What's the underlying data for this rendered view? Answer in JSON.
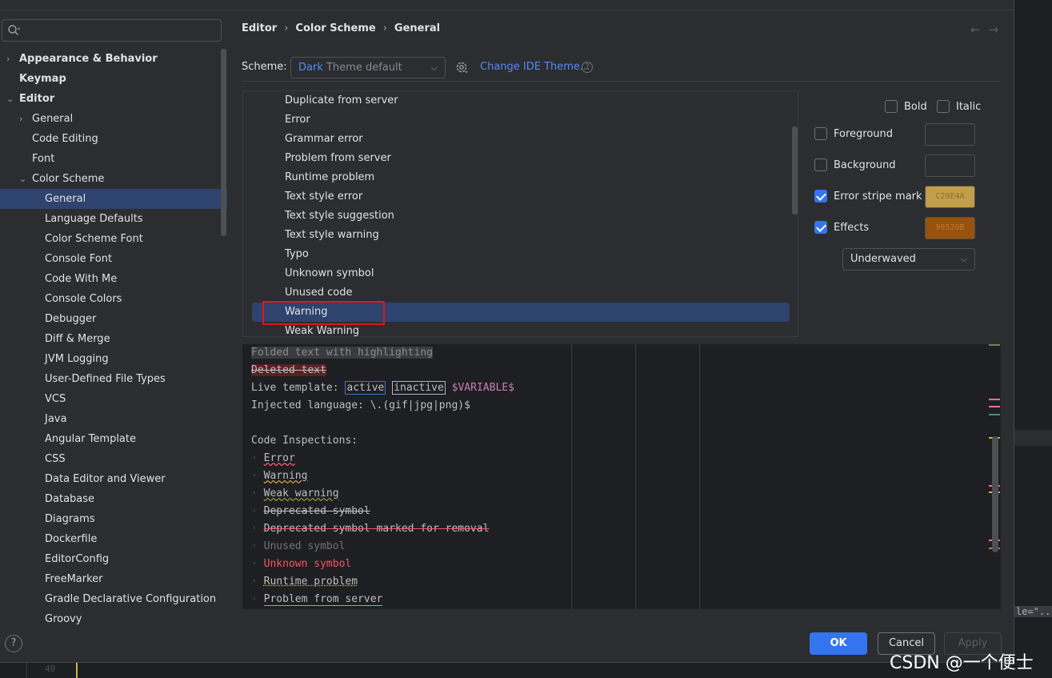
{
  "search": {
    "placeholder": ""
  },
  "sidebar": {
    "items": [
      {
        "label": "Appearance & Behavior",
        "level": 0,
        "bold": true,
        "arrow": "›"
      },
      {
        "label": "Keymap",
        "level": 0,
        "bold": true,
        "arrow": ""
      },
      {
        "label": "Editor",
        "level": 0,
        "bold": true,
        "arrow": "⌄"
      },
      {
        "label": "General",
        "level": 1,
        "bold": false,
        "arrow": "›"
      },
      {
        "label": "Code Editing",
        "level": 1,
        "bold": false,
        "arrow": ""
      },
      {
        "label": "Font",
        "level": 1,
        "bold": false,
        "arrow": ""
      },
      {
        "label": "Color Scheme",
        "level": 1,
        "bold": false,
        "arrow": "⌄"
      },
      {
        "label": "General",
        "level": 2,
        "bold": false,
        "arrow": "",
        "selected": true
      },
      {
        "label": "Language Defaults",
        "level": 2,
        "bold": false,
        "arrow": ""
      },
      {
        "label": "Color Scheme Font",
        "level": 2,
        "bold": false,
        "arrow": ""
      },
      {
        "label": "Console Font",
        "level": 2,
        "bold": false,
        "arrow": ""
      },
      {
        "label": "Code With Me",
        "level": 2,
        "bold": false,
        "arrow": ""
      },
      {
        "label": "Console Colors",
        "level": 2,
        "bold": false,
        "arrow": ""
      },
      {
        "label": "Debugger",
        "level": 2,
        "bold": false,
        "arrow": ""
      },
      {
        "label": "Diff & Merge",
        "level": 2,
        "bold": false,
        "arrow": ""
      },
      {
        "label": "JVM Logging",
        "level": 2,
        "bold": false,
        "arrow": ""
      },
      {
        "label": "User-Defined File Types",
        "level": 2,
        "bold": false,
        "arrow": ""
      },
      {
        "label": "VCS",
        "level": 2,
        "bold": false,
        "arrow": ""
      },
      {
        "label": "Java",
        "level": 2,
        "bold": false,
        "arrow": ""
      },
      {
        "label": "Angular Template",
        "level": 2,
        "bold": false,
        "arrow": ""
      },
      {
        "label": "CSS",
        "level": 2,
        "bold": false,
        "arrow": ""
      },
      {
        "label": "Data Editor and Viewer",
        "level": 2,
        "bold": false,
        "arrow": ""
      },
      {
        "label": "Database",
        "level": 2,
        "bold": false,
        "arrow": ""
      },
      {
        "label": "Diagrams",
        "level": 2,
        "bold": false,
        "arrow": ""
      },
      {
        "label": "Dockerfile",
        "level": 2,
        "bold": false,
        "arrow": ""
      },
      {
        "label": "EditorConfig",
        "level": 2,
        "bold": false,
        "arrow": ""
      },
      {
        "label": "FreeMarker",
        "level": 2,
        "bold": false,
        "arrow": ""
      },
      {
        "label": "Gradle Declarative Configuration",
        "level": 2,
        "bold": false,
        "arrow": ""
      },
      {
        "label": "Groovy",
        "level": 2,
        "bold": false,
        "arrow": ""
      }
    ]
  },
  "breadcrumb": [
    "Editor",
    "Color Scheme",
    "General"
  ],
  "nav": {
    "back": "←",
    "forward": "→"
  },
  "scheme": {
    "label": "Scheme:",
    "value_prefix": "Dark",
    "value_rest": " Theme default",
    "change_theme": "Change IDE Theme...",
    "help": "?"
  },
  "attributes": {
    "items": [
      "Duplicate from server",
      "Error",
      "Grammar error",
      "Problem from server",
      "Runtime problem",
      "Text style error",
      "Text style suggestion",
      "Text style warning",
      "Typo",
      "Unknown symbol",
      "Unused code",
      "Warning",
      "Weak Warning"
    ],
    "selected_index": 11
  },
  "options": {
    "bold": {
      "label": "Bold",
      "checked": false
    },
    "italic": {
      "label": "Italic",
      "checked": false
    },
    "foreground": {
      "label": "Foreground",
      "checked": false,
      "color": ""
    },
    "background": {
      "label": "Background",
      "checked": false,
      "color": ""
    },
    "error_stripe": {
      "label": "Error stripe mark",
      "checked": true,
      "color": "C29E4A",
      "swatch_bg": "#c29e4a",
      "swatch_fg": "#8a6d2a"
    },
    "effects": {
      "label": "Effects",
      "checked": true,
      "color": "99520B",
      "swatch_bg": "#99520b",
      "swatch_fg": "#c27a33"
    },
    "effect_type": "Underwaved"
  },
  "preview": {
    "folded": "Folded text with highlighting",
    "deleted": "Deleted text",
    "live_prefix": "Live template: ",
    "live_active": "active",
    "live_inactive": "inactive",
    "live_var": "$VARIABLE$",
    "injected": "Injected language: \\.(gif|jpg|png)$",
    "inspections_header": "Code Inspections:",
    "inspections": [
      {
        "text": "Error",
        "style": "err"
      },
      {
        "text": "Warning",
        "style": "warn"
      },
      {
        "text": "Weak warning",
        "style": "weak"
      },
      {
        "text": "Deprecated symbol",
        "style": "dep"
      },
      {
        "text": "Deprecated symbol marked for removal",
        "style": "deprm"
      },
      {
        "text": "Unused symbol",
        "style": "unused"
      },
      {
        "text": "Unknown symbol",
        "style": "unknown"
      },
      {
        "text": "Runtime problem",
        "style": "runtime"
      },
      {
        "text": "Problem from server",
        "style": "server"
      }
    ],
    "stripe_colors": [
      "#6a8759",
      "#ff6b9d",
      "#ff6b9d",
      "#4b8a7b",
      "#c9b84a",
      "#ff6b9d",
      "#c9b84a",
      "#ff6b9d",
      "#c97a3a"
    ]
  },
  "buttons": {
    "ok": "OK",
    "cancel": "Cancel",
    "apply": "Apply"
  },
  "background_editor": {
    "line_number": "40",
    "snippet": "le=\"..."
  },
  "watermark": "CSDN @一个便士"
}
